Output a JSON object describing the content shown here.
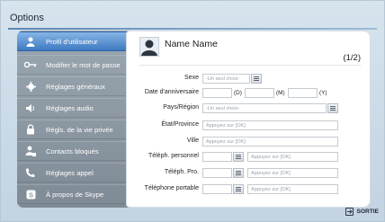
{
  "window": {
    "title": "Options"
  },
  "sidebar": {
    "items": [
      {
        "label": "Profil d'utilisateur",
        "active": true
      },
      {
        "label": "Modifier le mot de passe",
        "active": false
      },
      {
        "label": "Réglages généraux",
        "active": false
      },
      {
        "label": "Réglages audio",
        "active": false
      },
      {
        "label": "Régls. de la vie privée",
        "active": false
      },
      {
        "label": "Contacts bloqués",
        "active": false
      },
      {
        "label": "Réglages appel",
        "active": false
      },
      {
        "label": "À propos de Skype",
        "active": false
      }
    ]
  },
  "profile": {
    "name": "Name Name",
    "page_indicator": "(1/2)",
    "fields": {
      "sexe": {
        "label": "Sexe",
        "placeholder": "-Un seul choix-"
      },
      "birthday": {
        "label": "Date d'anniversaire",
        "day": "(D)",
        "month": "(M)",
        "year": "(Y)"
      },
      "country": {
        "label": "Pays/Région",
        "placeholder": "-Un seul choix-"
      },
      "state": {
        "label": "État/Province",
        "placeholder": "Appuyez sur [OK]"
      },
      "city": {
        "label": "Ville",
        "placeholder": "Appuyez sur [OK]"
      },
      "phone_personal": {
        "label": "Téléph. personnel",
        "placeholder": "Appuyez sur [OK]"
      },
      "phone_pro": {
        "label": "Téléph. Pro.",
        "placeholder": "Appuyez sur [OK]"
      },
      "phone_mobile": {
        "label": "Téléphone portable",
        "placeholder": "Appuyez sur [OK]"
      }
    }
  },
  "footer": {
    "exit_label": "SORTIE"
  },
  "colors": {
    "accent": "#3e79c1",
    "sidebar": "#8c98a2"
  }
}
